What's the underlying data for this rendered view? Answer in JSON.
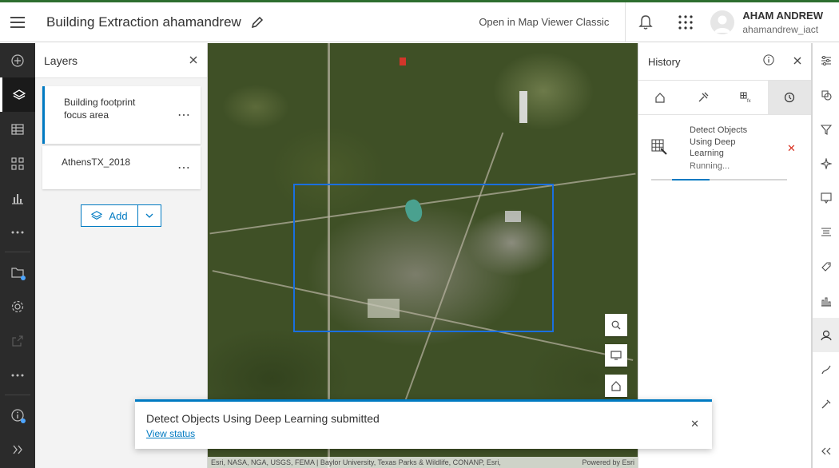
{
  "header": {
    "title": "Building Extraction ahamandrew",
    "classic_link": "Open in Map Viewer Classic",
    "user_name": "AHAM ANDREW",
    "user_id": "ahamandrew_iact"
  },
  "left_toolbar": {
    "items": [
      "add-icon",
      "layers-icon",
      "table-icon",
      "grid-icon",
      "chart-icon",
      "more-icon",
      "folder-icon",
      "settings-icon",
      "share-icon",
      "more-icon",
      "info-icon",
      "expand-icon"
    ],
    "active": "layers-icon"
  },
  "layers_panel": {
    "title": "Layers",
    "layers": [
      {
        "name": "Building footprint focus area",
        "menu": "⋯"
      },
      {
        "name": "AthensTX_2018",
        "menu": "⋯"
      }
    ],
    "add_label": "Add"
  },
  "map": {
    "attribution": "Esri, NASA, NGA, USGS, FEMA | Baylor University, Texas Parks & Wildlife, CONANP, Esri,",
    "powered_by": "Powered by Esri",
    "accent": "#1a6fe0"
  },
  "history_panel": {
    "title": "History",
    "tabs": [
      "home-icon",
      "tools-icon",
      "raster-function-icon",
      "history-icon"
    ],
    "active_tab": "history-icon",
    "job": {
      "name": "Detect Objects Using Deep Learning",
      "status": "Running...",
      "progress": 0.28
    }
  },
  "toast": {
    "title": "Detect Objects Using Deep Learning submitted",
    "link": "View status"
  },
  "colors": {
    "brand": "#2d6e2f",
    "accent": "#007ac2",
    "cancel": "#d83020"
  }
}
